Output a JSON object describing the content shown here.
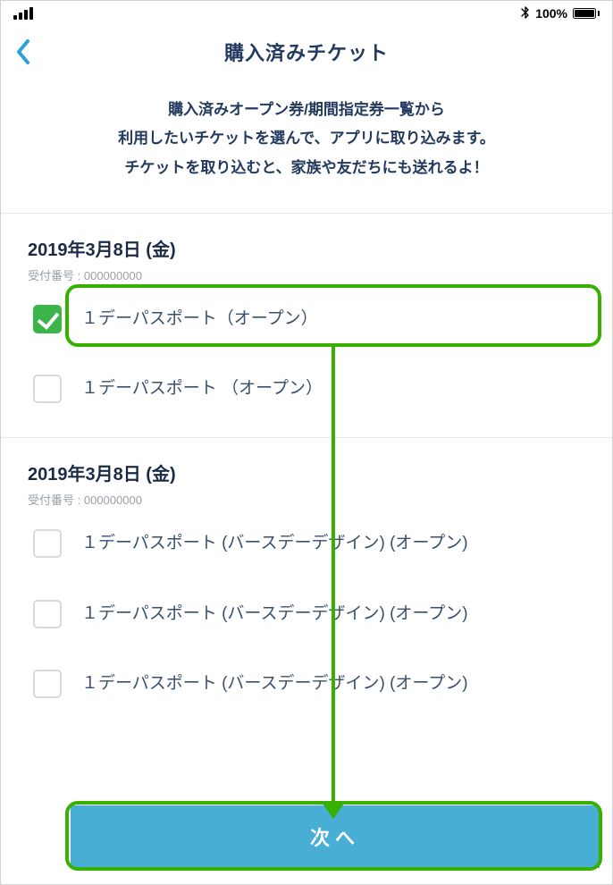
{
  "status_bar": {
    "bluetooth_icon": "bluetooth-icon",
    "battery_percent": "100%"
  },
  "nav": {
    "title": "購入済みチケット"
  },
  "description": {
    "line1": "購入済みオープン券/期間指定券一覧から",
    "line2": "利用したいチケットを選んで、アプリに取り込みます。",
    "line3": "チケットを取り込むと、家族や友だちにも送れるよ！"
  },
  "sections": [
    {
      "date": "2019年3月8日 (金)",
      "receipt_label": "受付番号",
      "receipt_no": "000000000",
      "tickets": [
        {
          "label": "１デーパスポート（オープン）",
          "checked": true
        },
        {
          "label": "１デーパスポート （オープン）",
          "checked": false
        }
      ]
    },
    {
      "date": "2019年3月8日 (金)",
      "receipt_label": "受付番号",
      "receipt_no": "000000000",
      "tickets": [
        {
          "label": "１デーパスポート (バースデーデザイン) (オープン)",
          "checked": false
        },
        {
          "label": "１デーパスポート (バースデーデザイン) (オープン)",
          "checked": false
        },
        {
          "label": "１デーパスポート (バースデーデザイン) (オープン)",
          "checked": false
        }
      ]
    }
  ],
  "next_button": {
    "label": "次へ"
  },
  "annotation": {
    "highlight_color": "#38b000"
  }
}
